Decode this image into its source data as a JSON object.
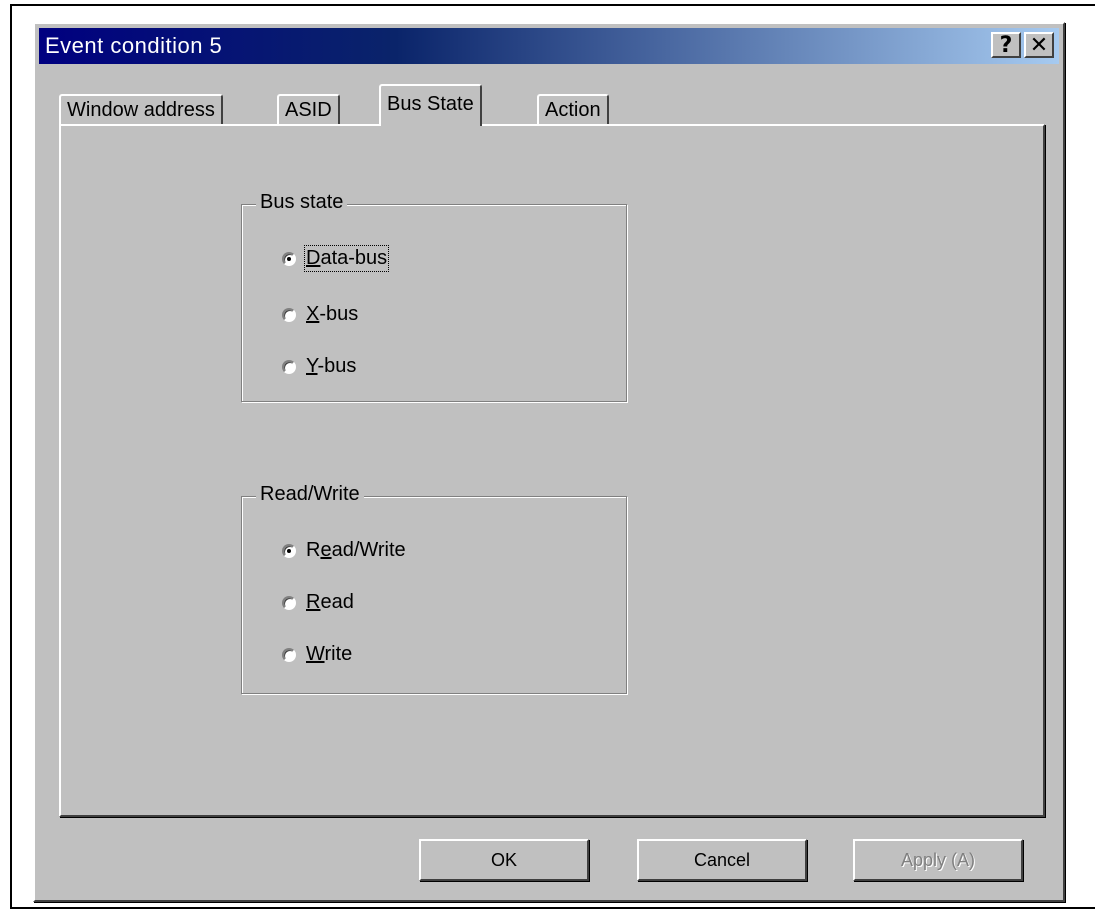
{
  "window": {
    "title": "Event condition 5",
    "help_label": "?",
    "close_label": "✕"
  },
  "tabs": [
    {
      "label": "Window address"
    },
    {
      "label": "ASID"
    },
    {
      "label": "Bus State",
      "active": true
    },
    {
      "label": "Action"
    }
  ],
  "bus_state": {
    "legend": "Bus state",
    "options": [
      {
        "prefix": "",
        "mnemonic": "D",
        "rest": "ata-bus",
        "checked": true
      },
      {
        "prefix": "",
        "mnemonic": "X",
        "rest": "-bus",
        "checked": false
      },
      {
        "prefix": "",
        "mnemonic": "Y",
        "rest": "-bus",
        "checked": false
      }
    ]
  },
  "read_write": {
    "legend": "Read/Write",
    "options": [
      {
        "prefix": "R",
        "mnemonic": "e",
        "rest": "ad/Write",
        "checked": true
      },
      {
        "prefix": "",
        "mnemonic": "R",
        "rest": "ead",
        "checked": false
      },
      {
        "prefix": "",
        "mnemonic": "W",
        "rest": "rite",
        "checked": false
      }
    ]
  },
  "buttons": {
    "ok": "OK",
    "cancel": "Cancel",
    "apply": "Apply (A)"
  }
}
